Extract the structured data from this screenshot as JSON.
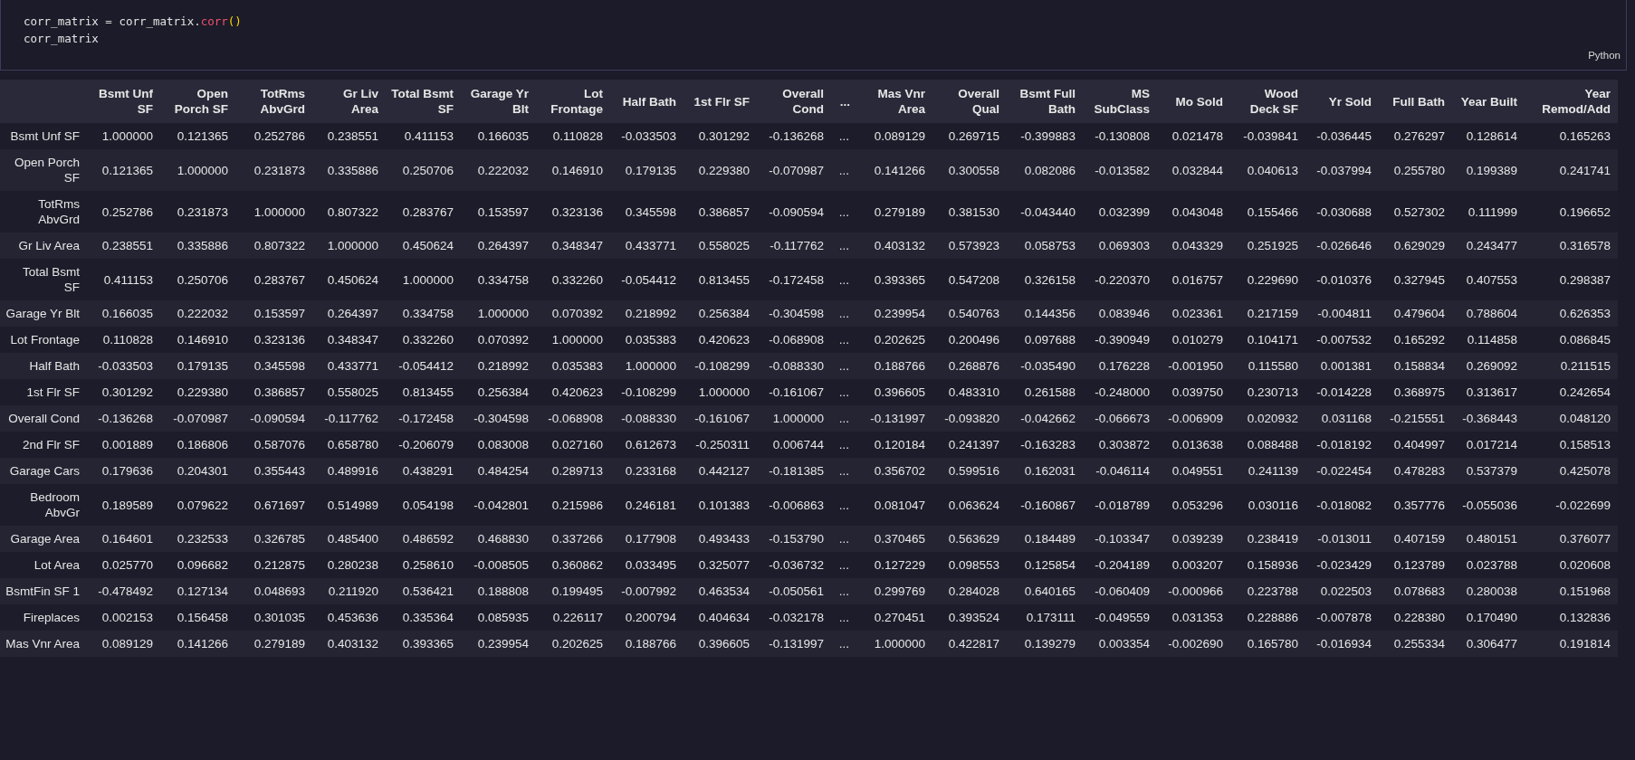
{
  "code_cell": {
    "lines": [
      [
        {
          "text": "corr_matrix",
          "kind": "name"
        },
        {
          "text": " = ",
          "kind": "operator"
        },
        {
          "text": "corr_matrix",
          "kind": "name"
        },
        {
          "text": ".",
          "kind": "punct"
        },
        {
          "text": "corr",
          "kind": "method"
        },
        {
          "text": "()",
          "kind": "bracket"
        }
      ],
      [
        {
          "text": "corr_matrix",
          "kind": "name"
        }
      ]
    ],
    "language": "Python"
  },
  "table": {
    "columns": [
      "Bsmt Unf SF",
      "Open Porch SF",
      "TotRms AbvGrd",
      "Gr Liv Area",
      "Total Bsmt SF",
      "Garage Yr Blt",
      "Lot Frontage",
      "Half Bath",
      "1st Flr SF",
      "Overall Cond",
      "...",
      "Mas Vnr Area",
      "Overall Qual",
      "Bsmt Full Bath",
      "MS SubClass",
      "Mo Sold",
      "Wood Deck SF",
      "Yr Sold",
      "Full Bath",
      "Year Built",
      "Year Remod/Add"
    ],
    "rows": [
      {
        "label": "Bsmt Unf SF",
        "cells": [
          "1.000000",
          "0.121365",
          "0.252786",
          "0.238551",
          "0.411153",
          "0.166035",
          "0.110828",
          "-0.033503",
          "0.301292",
          "-0.136268",
          "...",
          "0.089129",
          "0.269715",
          "-0.399883",
          "-0.130808",
          "0.021478",
          "-0.039841",
          "-0.036445",
          "0.276297",
          "0.128614",
          "0.165263"
        ]
      },
      {
        "label": "Open Porch SF",
        "cells": [
          "0.121365",
          "1.000000",
          "0.231873",
          "0.335886",
          "0.250706",
          "0.222032",
          "0.146910",
          "0.179135",
          "0.229380",
          "-0.070987",
          "...",
          "0.141266",
          "0.300558",
          "0.082086",
          "-0.013582",
          "0.032844",
          "0.040613",
          "-0.037994",
          "0.255780",
          "0.199389",
          "0.241741"
        ]
      },
      {
        "label": "TotRms AbvGrd",
        "cells": [
          "0.252786",
          "0.231873",
          "1.000000",
          "0.807322",
          "0.283767",
          "0.153597",
          "0.323136",
          "0.345598",
          "0.386857",
          "-0.090594",
          "...",
          "0.279189",
          "0.381530",
          "-0.043440",
          "0.032399",
          "0.043048",
          "0.155466",
          "-0.030688",
          "0.527302",
          "0.111999",
          "0.196652"
        ]
      },
      {
        "label": "Gr Liv Area",
        "cells": [
          "0.238551",
          "0.335886",
          "0.807322",
          "1.000000",
          "0.450624",
          "0.264397",
          "0.348347",
          "0.433771",
          "0.558025",
          "-0.117762",
          "...",
          "0.403132",
          "0.573923",
          "0.058753",
          "0.069303",
          "0.043329",
          "0.251925",
          "-0.026646",
          "0.629029",
          "0.243477",
          "0.316578"
        ]
      },
      {
        "label": "Total Bsmt SF",
        "cells": [
          "0.411153",
          "0.250706",
          "0.283767",
          "0.450624",
          "1.000000",
          "0.334758",
          "0.332260",
          "-0.054412",
          "0.813455",
          "-0.172458",
          "...",
          "0.393365",
          "0.547208",
          "0.326158",
          "-0.220370",
          "0.016757",
          "0.229690",
          "-0.010376",
          "0.327945",
          "0.407553",
          "0.298387"
        ]
      },
      {
        "label": "Garage Yr Blt",
        "cells": [
          "0.166035",
          "0.222032",
          "0.153597",
          "0.264397",
          "0.334758",
          "1.000000",
          "0.070392",
          "0.218992",
          "0.256384",
          "-0.304598",
          "...",
          "0.239954",
          "0.540763",
          "0.144356",
          "0.083946",
          "0.023361",
          "0.217159",
          "-0.004811",
          "0.479604",
          "0.788604",
          "0.626353"
        ]
      },
      {
        "label": "Lot Frontage",
        "cells": [
          "0.110828",
          "0.146910",
          "0.323136",
          "0.348347",
          "0.332260",
          "0.070392",
          "1.000000",
          "0.035383",
          "0.420623",
          "-0.068908",
          "...",
          "0.202625",
          "0.200496",
          "0.097688",
          "-0.390949",
          "0.010279",
          "0.104171",
          "-0.007532",
          "0.165292",
          "0.114858",
          "0.086845"
        ]
      },
      {
        "label": "Half Bath",
        "cells": [
          "-0.033503",
          "0.179135",
          "0.345598",
          "0.433771",
          "-0.054412",
          "0.218992",
          "0.035383",
          "1.000000",
          "-0.108299",
          "-0.088330",
          "...",
          "0.188766",
          "0.268876",
          "-0.035490",
          "0.176228",
          "-0.001950",
          "0.115580",
          "0.001381",
          "0.158834",
          "0.269092",
          "0.211515"
        ]
      },
      {
        "label": "1st Flr SF",
        "cells": [
          "0.301292",
          "0.229380",
          "0.386857",
          "0.558025",
          "0.813455",
          "0.256384",
          "0.420623",
          "-0.108299",
          "1.000000",
          "-0.161067",
          "...",
          "0.396605",
          "0.483310",
          "0.261588",
          "-0.248000",
          "0.039750",
          "0.230713",
          "-0.014228",
          "0.368975",
          "0.313617",
          "0.242654"
        ]
      },
      {
        "label": "Overall Cond",
        "cells": [
          "-0.136268",
          "-0.070987",
          "-0.090594",
          "-0.117762",
          "-0.172458",
          "-0.304598",
          "-0.068908",
          "-0.088330",
          "-0.161067",
          "1.000000",
          "...",
          "-0.131997",
          "-0.093820",
          "-0.042662",
          "-0.066673",
          "-0.006909",
          "0.020932",
          "0.031168",
          "-0.215551",
          "-0.368443",
          "0.048120"
        ]
      },
      {
        "label": "2nd Flr SF",
        "cells": [
          "0.001889",
          "0.186806",
          "0.587076",
          "0.658780",
          "-0.206079",
          "0.083008",
          "0.027160",
          "0.612673",
          "-0.250311",
          "0.006744",
          "...",
          "0.120184",
          "0.241397",
          "-0.163283",
          "0.303872",
          "0.013638",
          "0.088488",
          "-0.018192",
          "0.404997",
          "0.017214",
          "0.158513"
        ]
      },
      {
        "label": "Garage Cars",
        "cells": [
          "0.179636",
          "0.204301",
          "0.355443",
          "0.489916",
          "0.438291",
          "0.484254",
          "0.289713",
          "0.233168",
          "0.442127",
          "-0.181385",
          "...",
          "0.356702",
          "0.599516",
          "0.162031",
          "-0.046114",
          "0.049551",
          "0.241139",
          "-0.022454",
          "0.478283",
          "0.537379",
          "0.425078"
        ]
      },
      {
        "label": "Bedroom AbvGr",
        "cells": [
          "0.189589",
          "0.079622",
          "0.671697",
          "0.514989",
          "0.054198",
          "-0.042801",
          "0.215986",
          "0.246181",
          "0.101383",
          "-0.006863",
          "...",
          "0.081047",
          "0.063624",
          "-0.160867",
          "-0.018789",
          "0.053296",
          "0.030116",
          "-0.018082",
          "0.357776",
          "-0.055036",
          "-0.022699"
        ]
      },
      {
        "label": "Garage Area",
        "cells": [
          "0.164601",
          "0.232533",
          "0.326785",
          "0.485400",
          "0.486592",
          "0.468830",
          "0.337266",
          "0.177908",
          "0.493433",
          "-0.153790",
          "...",
          "0.370465",
          "0.563629",
          "0.184489",
          "-0.103347",
          "0.039239",
          "0.238419",
          "-0.013011",
          "0.407159",
          "0.480151",
          "0.376077"
        ]
      },
      {
        "label": "Lot Area",
        "cells": [
          "0.025770",
          "0.096682",
          "0.212875",
          "0.280238",
          "0.258610",
          "-0.008505",
          "0.360862",
          "0.033495",
          "0.325077",
          "-0.036732",
          "...",
          "0.127229",
          "0.098553",
          "0.125854",
          "-0.204189",
          "0.003207",
          "0.158936",
          "-0.023429",
          "0.123789",
          "0.023788",
          "0.020608"
        ]
      },
      {
        "label": "BsmtFin SF 1",
        "cells": [
          "-0.478492",
          "0.127134",
          "0.048693",
          "0.211920",
          "0.536421",
          "0.188808",
          "0.199495",
          "-0.007992",
          "0.463534",
          "-0.050561",
          "...",
          "0.299769",
          "0.284028",
          "0.640165",
          "-0.060409",
          "-0.000966",
          "0.223788",
          "0.022503",
          "0.078683",
          "0.280038",
          "0.151968"
        ]
      },
      {
        "label": "Fireplaces",
        "cells": [
          "0.002153",
          "0.156458",
          "0.301035",
          "0.453636",
          "0.335364",
          "0.085935",
          "0.226117",
          "0.200794",
          "0.404634",
          "-0.032178",
          "...",
          "0.270451",
          "0.393524",
          "0.173111",
          "-0.049559",
          "0.031353",
          "0.228886",
          "-0.007878",
          "0.228380",
          "0.170490",
          "0.132836"
        ]
      },
      {
        "label": "Mas Vnr Area",
        "cells": [
          "0.089129",
          "0.141266",
          "0.279189",
          "0.403132",
          "0.393365",
          "0.239954",
          "0.202625",
          "0.188766",
          "0.396605",
          "-0.131997",
          "...",
          "1.000000",
          "0.422817",
          "0.139279",
          "0.003354",
          "-0.002690",
          "0.165780",
          "-0.016934",
          "0.255334",
          "0.306477",
          "0.191814"
        ]
      }
    ]
  }
}
